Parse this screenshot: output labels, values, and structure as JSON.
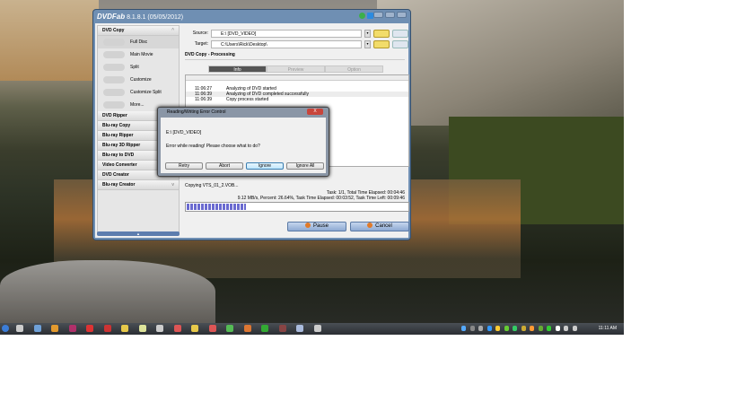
{
  "window": {
    "app": "DVDFab",
    "version": "8.1.8.1 (05/05/2012)"
  },
  "sidebar": {
    "dvd_copy": "DVD Copy",
    "modes": [
      "Full Disc",
      "Main Movie",
      "Split",
      "Customize",
      "Customize Split",
      "More..."
    ],
    "sections": [
      "DVD Ripper",
      "Blu-ray Copy",
      "Blu-ray Ripper",
      "Blu-ray 3D Ripper",
      "Blu-ray to DVD",
      "Video Converter",
      "DVD Creator",
      "Blu-ray Creator"
    ],
    "collapse": "▲"
  },
  "main": {
    "source_label": "Source:",
    "source_value": "E:\\ [DVD_VIDEO]",
    "target_label": "Target:",
    "target_value": "C:\\Users\\Rick\\Desktop\\",
    "section": "DVD Copy  -  Processing",
    "tabs": [
      "Info",
      "Preview",
      "Option"
    ],
    "log": [
      {
        "time": "11:06:27",
        "msg": "Analyzing of DVD started"
      },
      {
        "time": "11:06:39",
        "msg": "Analyzing of DVD completed successfully"
      },
      {
        "time": "11:06:39",
        "msg": "Copy process started"
      }
    ],
    "status": "Copying VTS_01_2.VOB...",
    "stats1": "Task: 1/1,  Total Time Elapsed: 00:04:46",
    "stats2": "9.12 MB/s,  Percent: 26.64%,  Task Time Elapsed: 00:03:52,  Task Time Left: 00:09:46",
    "progress_percent": 26.64,
    "pause": "Pause",
    "cancel": "Cancel"
  },
  "dialog": {
    "title": "Reading/Writing Error Control",
    "close": "X",
    "path": "E:\\ [DVD_VIDEO]",
    "message": "Error while reading! Please choose what to do?",
    "buttons": [
      "Retry",
      "Abort",
      "Ignore",
      "Ignore All"
    ]
  },
  "taskbar": {
    "clock": "11:11 AM"
  }
}
